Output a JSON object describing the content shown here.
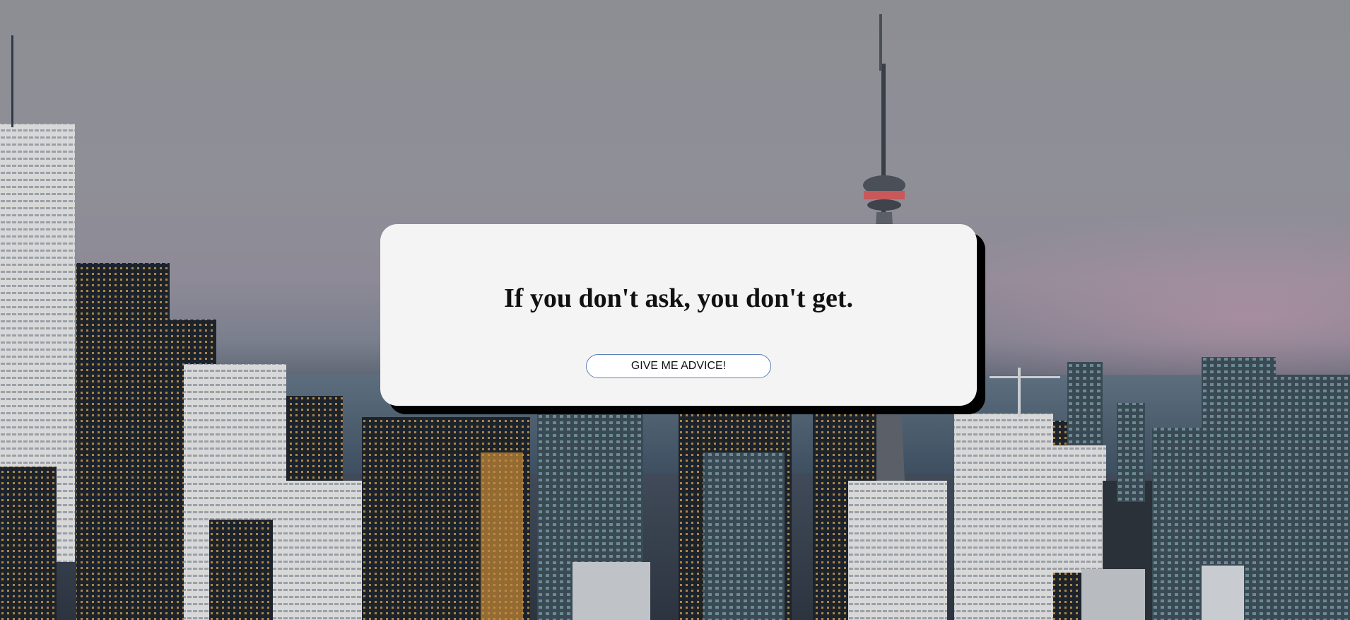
{
  "quote": {
    "text": "If you don't ask, you don't get."
  },
  "button": {
    "label": "GIVE ME ADVICE!"
  },
  "colors": {
    "card_background": "#f4f4f4",
    "card_shadow": "#000000",
    "button_border": "#5b7fb8",
    "text": "#111111"
  },
  "background": {
    "description_icon": "city-skyline-photo"
  }
}
